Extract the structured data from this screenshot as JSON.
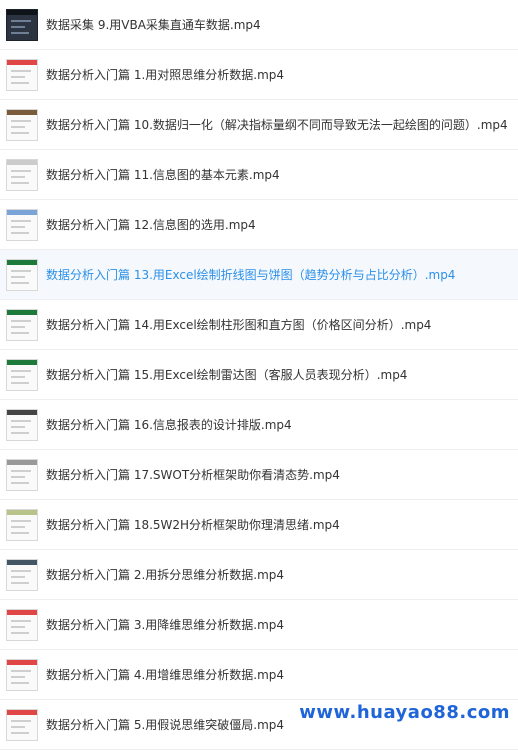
{
  "files": [
    {
      "label": "数据采集 9.用VBA采集直通车数据.mp4",
      "thumb": "dark",
      "accent": "#0f1419"
    },
    {
      "label": "数据分析入门篇 1.用对照思维分析数据.mp4",
      "thumb": "light",
      "accent": "#e04646"
    },
    {
      "label": "数据分析入门篇 10.数据归一化（解决指标量纲不同而导致无法一起绘图的问题）.mp4",
      "thumb": "light",
      "accent": "#7a5b3c"
    },
    {
      "label": "数据分析入门篇 11.信息图的基本元素.mp4",
      "thumb": "light",
      "accent": "#cccccc"
    },
    {
      "label": "数据分析入门篇 12.信息图的选用.mp4",
      "thumb": "light",
      "accent": "#7aa3d8"
    },
    {
      "label": "数据分析入门篇 13.用Excel绘制折线图与饼图（趋势分析与占比分析）.mp4",
      "thumb": "light",
      "accent": "#1d7a3a",
      "active": true
    },
    {
      "label": "数据分析入门篇 14.用Excel绘制柱形图和直方图（价格区间分析）.mp4",
      "thumb": "light",
      "accent": "#1d7a3a"
    },
    {
      "label": "数据分析入门篇 15.用Excel绘制雷达图（客服人员表现分析）.mp4",
      "thumb": "light",
      "accent": "#1d7a3a"
    },
    {
      "label": "数据分析入门篇 16.信息报表的设计排版.mp4",
      "thumb": "light",
      "accent": "#444444"
    },
    {
      "label": "数据分析入门篇 17.SWOT分析框架助你看清态势.mp4",
      "thumb": "light",
      "accent": "#999999"
    },
    {
      "label": "数据分析入门篇 18.5W2H分析框架助你理清思绪.mp4",
      "thumb": "light",
      "accent": "#b8c48a"
    },
    {
      "label": "数据分析入门篇 2.用拆分思维分析数据.mp4",
      "thumb": "light",
      "accent": "#445566"
    },
    {
      "label": "数据分析入门篇 3.用降维思维分析数据.mp4",
      "thumb": "light",
      "accent": "#e04646"
    },
    {
      "label": "数据分析入门篇 4.用增维思维分析数据.mp4",
      "thumb": "light",
      "accent": "#e04646"
    },
    {
      "label": "数据分析入门篇 5.用假说思维突破僵局.mp4",
      "thumb": "light",
      "accent": "#e04646"
    }
  ],
  "watermark": "www.huayao88.com",
  "colors": {
    "active_text": "#2b8fe8",
    "watermark": "#1f64d8"
  }
}
